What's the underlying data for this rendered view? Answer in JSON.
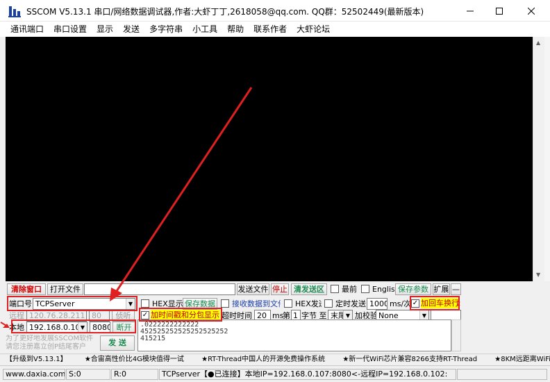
{
  "window": {
    "title": "SSCOM V5.13.1 串口/网络数据调试器,作者:大虾丁丁,2618058@qq.com. QQ群：52502449(最新版本)"
  },
  "menu": [
    "通讯端口",
    "串口设置",
    "显示",
    "发送",
    "多字符串",
    "小工具",
    "帮助",
    "联系作者",
    "大虾论坛"
  ],
  "toolbar": {
    "clear_window": "清除窗口",
    "open_file": "打开文件",
    "file_path": "",
    "send_file": "发送文件",
    "stop": "停止",
    "clear_send_area": "清发送区",
    "topmost": "最前",
    "english": "English",
    "save_params": "保存参数",
    "expand": "扩展",
    "collapse": "—"
  },
  "port": {
    "label": "端口号",
    "value": "TCPServer",
    "hex_display": "HEX显示",
    "save_data": "保存数据",
    "recv_to_file": "接收数据到文件",
    "hex_send": "HEX发送",
    "timed_send": "定时发送",
    "interval": "1000",
    "interval_unit": "ms/次",
    "add_crlf": "加回车换行",
    "add_crlf_checked": true,
    "marker": "2"
  },
  "remote": {
    "label": "远程",
    "ip": "120.76.28.211",
    "port": "80",
    "listen": "侦听",
    "timestamp": "加时间戳和分包显示",
    "timestamp_checked": true,
    "timeout_label": "超时时间",
    "timeout": "20",
    "timeout_unit": "ms",
    "nth_label": "第",
    "byte_index": "1",
    "byte_label": "字节 至",
    "end_sel": "末尾",
    "checksum_label": "加校验",
    "checksum": "None"
  },
  "local": {
    "label": "本地",
    "ip": "192.168.0.107",
    "port": "8080",
    "disconnect": "断开"
  },
  "send": {
    "button": "发 送",
    "lines": [
      ".0222222222222",
      "452525252525252525252",
      "415215"
    ]
  },
  "promo": {
    "line1": "为了更好地发展SSCOM软件",
    "line2": "请您注册嘉立创P结尾客户"
  },
  "ads": [
    "【升级到V5.13.1】",
    "★合宙高性价比4G模块值得一试",
    "★RT-Thread中国人的开源免费操作系统",
    "★新一代WiFi芯片兼容8266支持RT-Thread",
    "★8KM远距离WiFi可自组网"
  ],
  "status": {
    "site": "www.daxia.com",
    "sent": "S:0",
    "recv": "R:0",
    "conn": "TCPserver【●已连接】本地IP=192.168.0.107:8080<-远程IP=192.168.0.102:"
  },
  "colors": {
    "red_annotation": "#e02020",
    "recv_bg": "#000000"
  }
}
